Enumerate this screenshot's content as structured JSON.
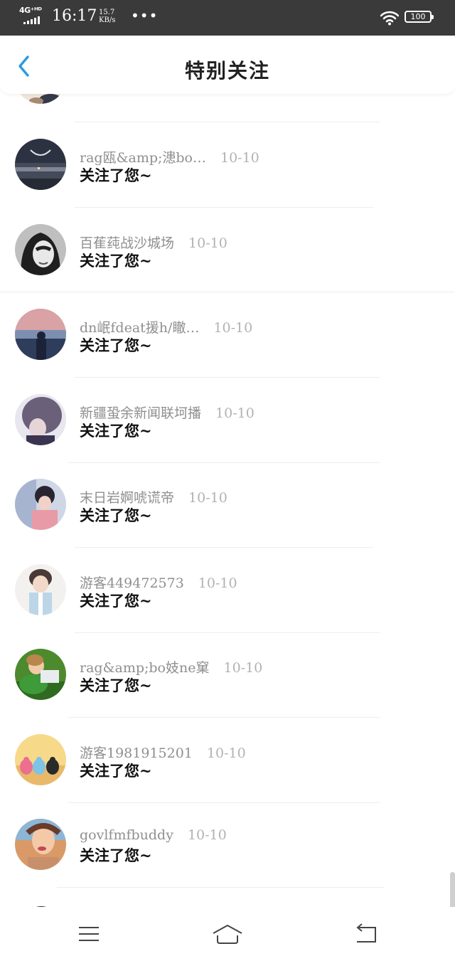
{
  "status_bar": {
    "network": "4G⁺ᴴᴰ",
    "time": "16:17",
    "speed_value": "15.7",
    "speed_unit": "KB/s",
    "more": "•••",
    "battery": "100"
  },
  "header": {
    "title": "特别关注",
    "back_icon": "chevron-left-icon",
    "accent_color": "#2a9bdf"
  },
  "items": [
    {
      "name": "rag瓯&amp;漶bo…",
      "date": "10-10",
      "message": "关注了您~"
    },
    {
      "name": "百萑莼战沙城场",
      "date": "10-10",
      "message": "关注了您~"
    },
    {
      "name": "dn岷fdeat援h/瞮…",
      "date": "10-10",
      "message": "关注了您~"
    },
    {
      "name": "新疆蛩余新闻联坷播",
      "date": "10-10",
      "message": "关注了您~"
    },
    {
      "name": "末日岩婀唬谎帝",
      "date": "10-10",
      "message": "关注了您~"
    },
    {
      "name": "游客449472573",
      "date": "10-10",
      "message": "关注了您~"
    },
    {
      "name": "rag&amp;bo妓ne窠",
      "date": "10-10",
      "message": "关注了您~"
    },
    {
      "name": "游客1981915201",
      "date": "10-10",
      "message": "关注了您~"
    },
    {
      "name": "govlfmfbuddy",
      "date": "10-10",
      "message": "关注了您~"
    }
  ],
  "nav_bar": {
    "menu_icon": "menu-icon",
    "home_icon": "home-icon",
    "back_icon": "return-icon"
  }
}
